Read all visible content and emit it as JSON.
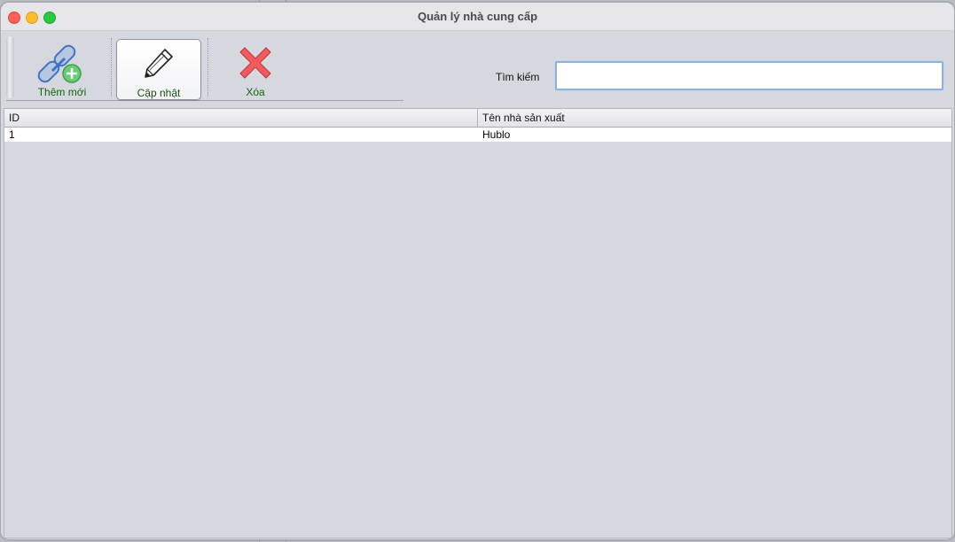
{
  "window": {
    "title": "Quản lý nhà cung cấp"
  },
  "toolbar": {
    "buttons": [
      {
        "label": "Thêm mới",
        "icon": "link-add-icon"
      },
      {
        "label": "Cập nhật",
        "icon": "pencil-icon"
      },
      {
        "label": "Xóa",
        "icon": "delete-x-icon"
      }
    ]
  },
  "search": {
    "label": "Tìm kiếm",
    "value": "",
    "placeholder": ""
  },
  "table": {
    "columns": [
      "ID",
      "Tên nhà sản xuất"
    ],
    "rows": [
      [
        "1",
        "Hublo"
      ]
    ]
  },
  "colors": {
    "toolbar_label": "#116611",
    "delete_icon": "#e8454a",
    "link_icon": "#4f86d6",
    "add_badge": "#5cc16a"
  }
}
